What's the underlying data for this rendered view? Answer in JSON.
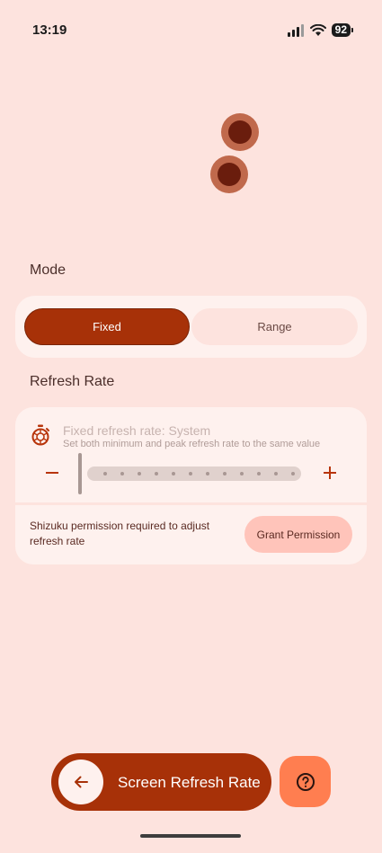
{
  "status_bar": {
    "time": "13:19",
    "battery": "92"
  },
  "mode": {
    "label": "Mode",
    "options": [
      {
        "label": "Fixed",
        "selected": true
      },
      {
        "label": "Range",
        "selected": false
      }
    ]
  },
  "refresh_rate": {
    "label": "Refresh Rate",
    "title": "Fixed refresh rate: System",
    "description": "Set both minimum and peak refresh rate to the same value",
    "slider_value_fraction": 0,
    "permission_text": "Shizuku permission required to adjust refresh rate",
    "grant_button": "Grant Permission"
  },
  "bottom_bar": {
    "title": "Screen Refresh Rate"
  },
  "colors": {
    "background": "#FDE3DE",
    "card": "#FEF1EE",
    "accent": "#A73108",
    "help_button": "#FF7E50",
    "grant_button": "#FFC4BA"
  },
  "icons": {
    "back": "arrow-left-icon",
    "help": "question-circle-icon",
    "timer": "timer-icon",
    "minus": "minus-icon",
    "plus": "plus-icon"
  }
}
